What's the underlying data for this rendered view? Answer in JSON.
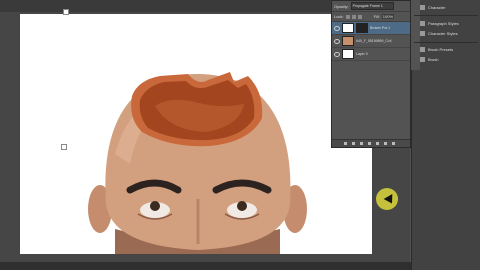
{
  "layers_panel": {
    "opacity_label": "Opacity:",
    "propagate_label": "Propagate Frame 1",
    "lock_label": "Lock:",
    "fill_label": "Fill:",
    "fill_value": "100%",
    "layers": [
      {
        "name": "Broken Pot 1",
        "active": true
      },
      {
        "name": "640_F_55159899_Cv4...",
        "active": false
      },
      {
        "name": "Layer 0",
        "active": false
      }
    ]
  },
  "dock": {
    "items": [
      {
        "label": "Character",
        "icon": "character-icon"
      },
      {
        "label": "Paragraph Styles",
        "icon": "paragraph-styles-icon"
      },
      {
        "label": "Character Styles",
        "icon": "character-styles-icon"
      },
      {
        "label": "Brush Presets",
        "icon": "brush-presets-icon"
      },
      {
        "label": "Brush",
        "icon": "brush-icon"
      }
    ]
  },
  "colors": {
    "workspace": "#464646",
    "panel": "#535353",
    "active_layer": "#4d6b86",
    "cursor_highlight": "#dcd73c"
  }
}
